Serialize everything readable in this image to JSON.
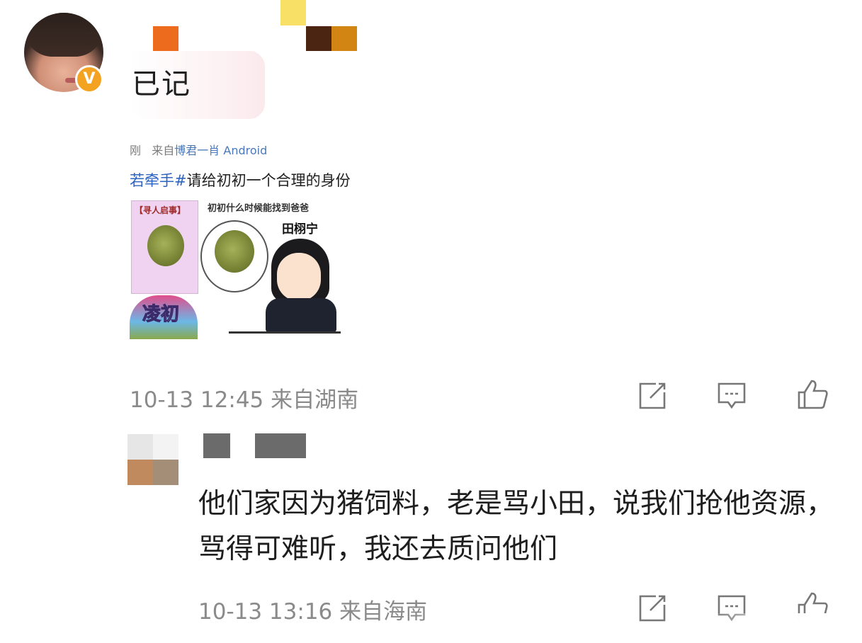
{
  "comment": {
    "text": "已记",
    "timestamp": "10-13 12:45",
    "location": "来自湖南",
    "quoted_post": {
      "time_prefix": "刚",
      "source_prefix": "来自",
      "source": "博君一肖 Android",
      "hashtag_fragment": "若牵手#",
      "text": "请给初初一个合理的身份",
      "image": {
        "poster_header": "【寻人启事】",
        "caption_top": "初初什么时候能找到爸爸",
        "name_label": "田栩宁",
        "sticker_label": "凌初"
      }
    }
  },
  "reply": {
    "text": "他们家因为猪饲料，老是骂小田，说我们抢他资源，骂得可难听，我还去质问他们",
    "timestamp": "10-13 13:16",
    "location": "来自海南"
  },
  "icons": [
    "share-icon",
    "comment-icon",
    "like-icon"
  ],
  "colors": {
    "badge": "#f3a321",
    "hashtag": "#2d63c1",
    "meta_gray": "#8a8a8a"
  }
}
